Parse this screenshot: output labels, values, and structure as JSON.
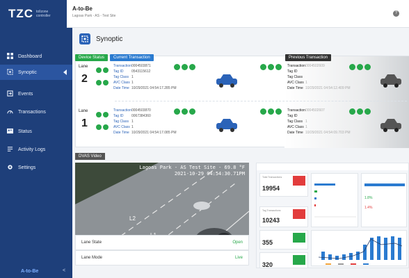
{
  "header": {
    "logo_text": "TZC",
    "logo_sub_1": "tollzone",
    "logo_sub_2": "controller",
    "app_title": "A-to-Be",
    "site_subtitle": "Lagoas Park - AS - Test Site",
    "help_icon": "?"
  },
  "sidebar": {
    "items": [
      {
        "label": "Dashboard",
        "icon": "dashboard-icon"
      },
      {
        "label": "Synoptic",
        "icon": "synoptic-icon"
      },
      {
        "label": "Events",
        "icon": "events-icon"
      },
      {
        "label": "Transactions",
        "icon": "transactions-icon"
      },
      {
        "label": "Status",
        "icon": "status-icon"
      },
      {
        "label": "Activity Logs",
        "icon": "activity-logs-icon"
      },
      {
        "label": "Settings",
        "icon": "settings-icon"
      }
    ],
    "active": "Synoptic",
    "brand": "A-to-Be",
    "collapse": "<"
  },
  "page": {
    "title": "Synoptic"
  },
  "tabs": {
    "device_status": "Device Status",
    "current": "Current Transaction",
    "previous": "Previous Transaction"
  },
  "lanes": [
    {
      "label": "Lane",
      "number": "2",
      "current": {
        "transaction": "0004503871",
        "tag_id": "0543115612",
        "tag_class": "1",
        "avc_class": "1",
        "date_time": "10/29/2021 04:54:17.285 PM"
      },
      "previous": {
        "transaction": "0004502609",
        "tag_id": "",
        "tag_class": "",
        "avc_class": "1",
        "date_time": "10/29/2021 04:54:12.409 PM"
      }
    },
    {
      "label": "Lane",
      "number": "1",
      "current": {
        "transaction": "0004503870",
        "tag_id": "0067384360",
        "tag_class": "1",
        "avc_class": "1",
        "date_time": "10/29/2021 04:54:17.085 PM"
      },
      "previous": {
        "transaction": "0004502607",
        "tag_id": "",
        "tag_class": "1",
        "avc_class": "1",
        "date_time": "10/29/2021 04:54:09.703 PM"
      }
    }
  ],
  "tx_labels": {
    "transaction": "Transaction",
    "tag_id": "Tag ID",
    "tag_class": "Tag Class",
    "avc_class": "AVC Class",
    "date_time": "Date Time"
  },
  "dvas": {
    "tab": "DVAS Video",
    "overlay_line1": "Lagoas Park - AS Test Site - 69.8 °F",
    "overlay_line2": "2021-10-29 04:54:30.71PM",
    "lane_markers": [
      "L2",
      "L1"
    ]
  },
  "lane_state": {
    "label": "Lane State",
    "value": "Open"
  },
  "lane_mode": {
    "label": "Lane Mode",
    "value": "Live"
  },
  "dashboard": {
    "kpis": [
      {
        "label": "Total Transactions",
        "value": "19954",
        "badge": "red"
      },
      {
        "label": "Tag Transactions",
        "value": "10243",
        "badge": "red"
      },
      {
        "label": "",
        "value": "355",
        "badge": "green"
      },
      {
        "label": "",
        "value": "320",
        "badge": "green"
      }
    ],
    "percentages": [
      "1.8%",
      "1.4%"
    ]
  }
}
